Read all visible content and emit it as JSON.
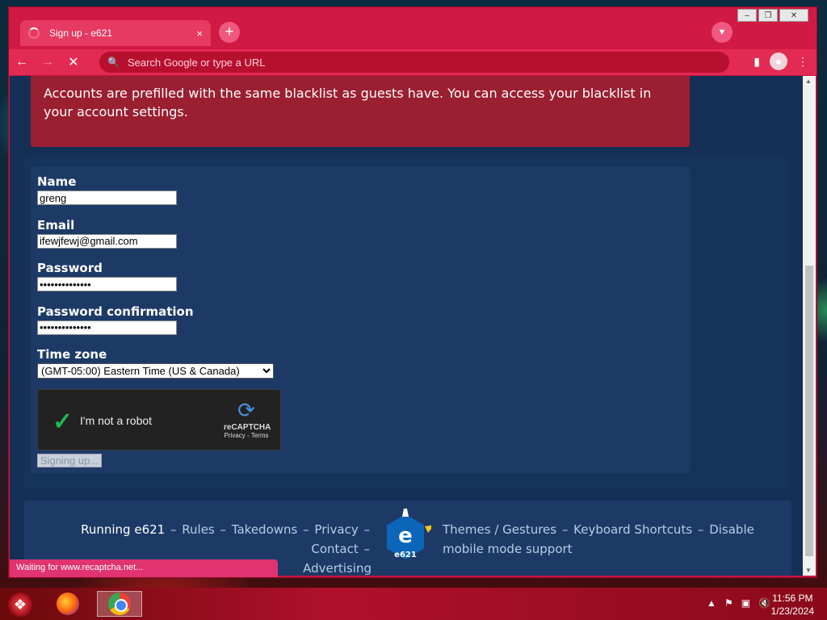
{
  "browser": {
    "tab_title": "Sign up - e621",
    "tab_close": "×",
    "new_tab": "+",
    "omnibox_placeholder": "Search Google or type a URL",
    "status_text": "Waiting for www.recaptcha.net..."
  },
  "page": {
    "banner_text": "Accounts are prefilled with the same blacklist as guests have. You can access your blacklist in your account settings.",
    "form": {
      "name_label": "Name",
      "name_value": "greng",
      "email_label": "Email",
      "email_value": "ifewjfewj@gmail.com",
      "password_label": "Password",
      "password_value": "••••••••••••••",
      "password_confirm_label": "Password confirmation",
      "password_confirm_value": "••••••••••••••",
      "timezone_label": "Time zone",
      "timezone_value": "(GMT-05:00) Eastern Time (US & Canada)",
      "recaptcha_label": "I'm not a robot",
      "recaptcha_brand": "reCAPTCHA",
      "recaptcha_privacy": "Privacy",
      "recaptcha_terms": "Terms",
      "submit_label": "Signing up..."
    },
    "footer": {
      "running": "Running e621",
      "links_left": [
        "Rules",
        "Takedowns",
        "Privacy",
        "Contact",
        "Advertising"
      ],
      "links_right": [
        "Themes / Gestures",
        "Keyboard Shortcuts",
        "Disable mobile mode support"
      ],
      "separator": "–",
      "logo_text": "e621"
    }
  },
  "taskbar": {
    "time": "11:56 PM",
    "date": "1/23/2024"
  },
  "colors": {
    "browser_accent": "#d01a44",
    "page_bg": "#152f56",
    "banner_bg": "#9a1f30",
    "panel_bg": "#1d3a66",
    "link": "#b6cbe6"
  }
}
